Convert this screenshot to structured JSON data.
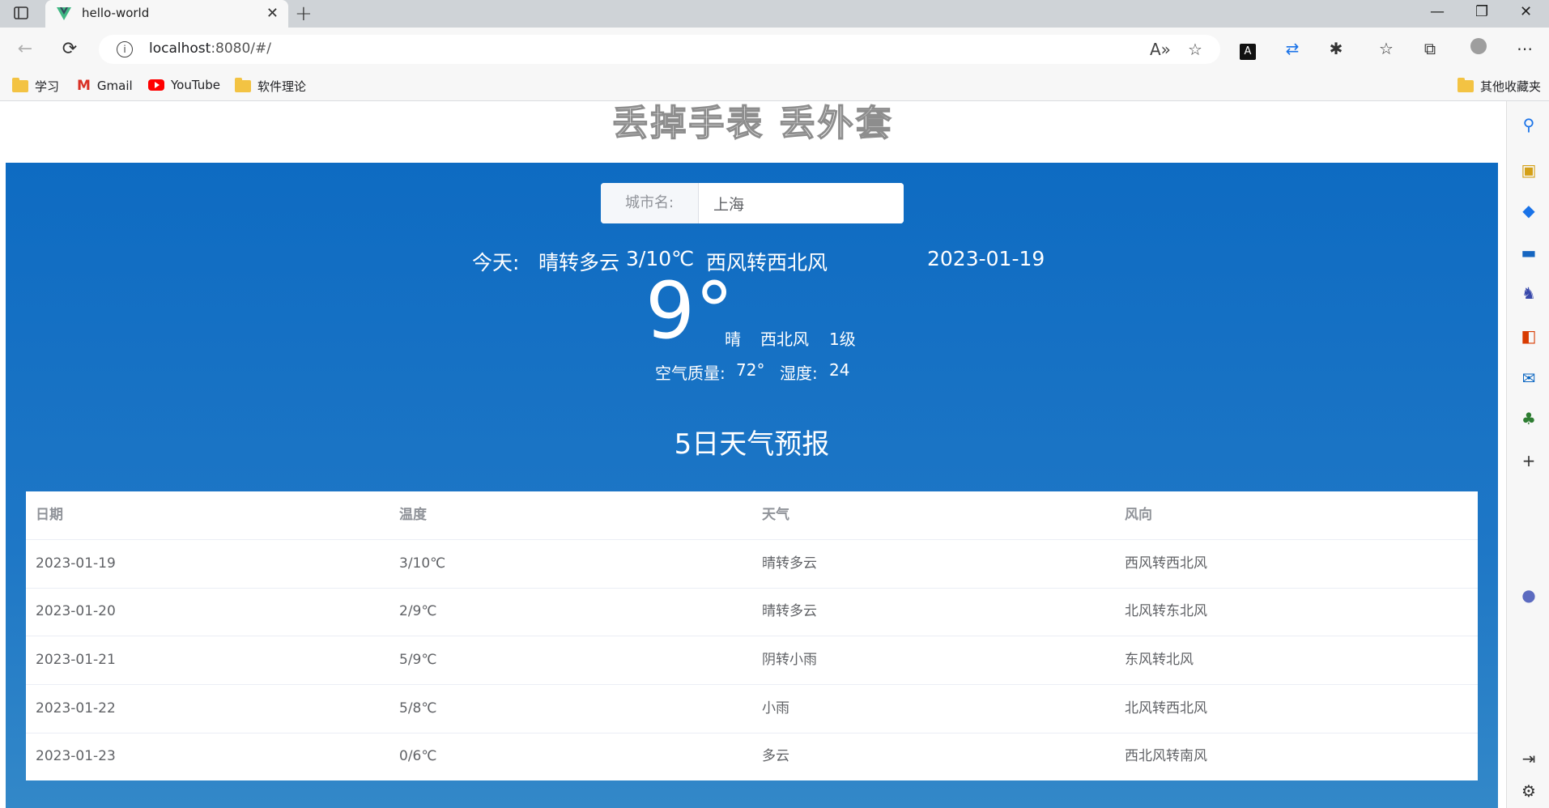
{
  "browser": {
    "tab_title": "hello-world",
    "url_host": "localhost",
    "url_rest": ":8080/#/",
    "bookmarks": [
      {
        "label": "学习",
        "icon": "folder-icon"
      },
      {
        "label": "Gmail",
        "icon": "gmail-icon"
      },
      {
        "label": "YouTube",
        "icon": "youtube-icon"
      },
      {
        "label": "软件理论",
        "icon": "folder-icon"
      }
    ],
    "other_bookmarks": "其他收藏夹"
  },
  "page": {
    "headline": "丢掉手表  丢外套",
    "search": {
      "prefix": "城市名:",
      "value": "上海"
    },
    "today": {
      "label": "今天:",
      "weather": "晴转多云",
      "temp_range": "3/10℃",
      "wind": "西风转西北风",
      "date": "2023-01-19"
    },
    "current": {
      "temp": "9°",
      "condition": "晴",
      "wind_dir": "西北风",
      "wind_level": "1级"
    },
    "air": {
      "quality_label": "空气质量:",
      "quality_value": "72°",
      "humidity_label": "湿度:",
      "humidity_value": "24"
    },
    "forecast_title": "5日天气预报",
    "table": {
      "headers": [
        "日期",
        "温度",
        "天气",
        "风向"
      ],
      "rows": [
        [
          "2023-01-19",
          "3/10℃",
          "晴转多云",
          "西风转西北风"
        ],
        [
          "2023-01-20",
          "2/9℃",
          "晴转多云",
          "北风转东北风"
        ],
        [
          "2023-01-21",
          "5/9℃",
          "阴转小雨",
          "东风转北风"
        ],
        [
          "2023-01-22",
          "5/8℃",
          "小雨",
          "北风转西北风"
        ],
        [
          "2023-01-23",
          "0/6℃",
          "多云",
          "西北风转南风"
        ]
      ]
    }
  },
  "colors": {
    "panel": "#0e6bc2",
    "panel_bottom": "#3388c8"
  }
}
